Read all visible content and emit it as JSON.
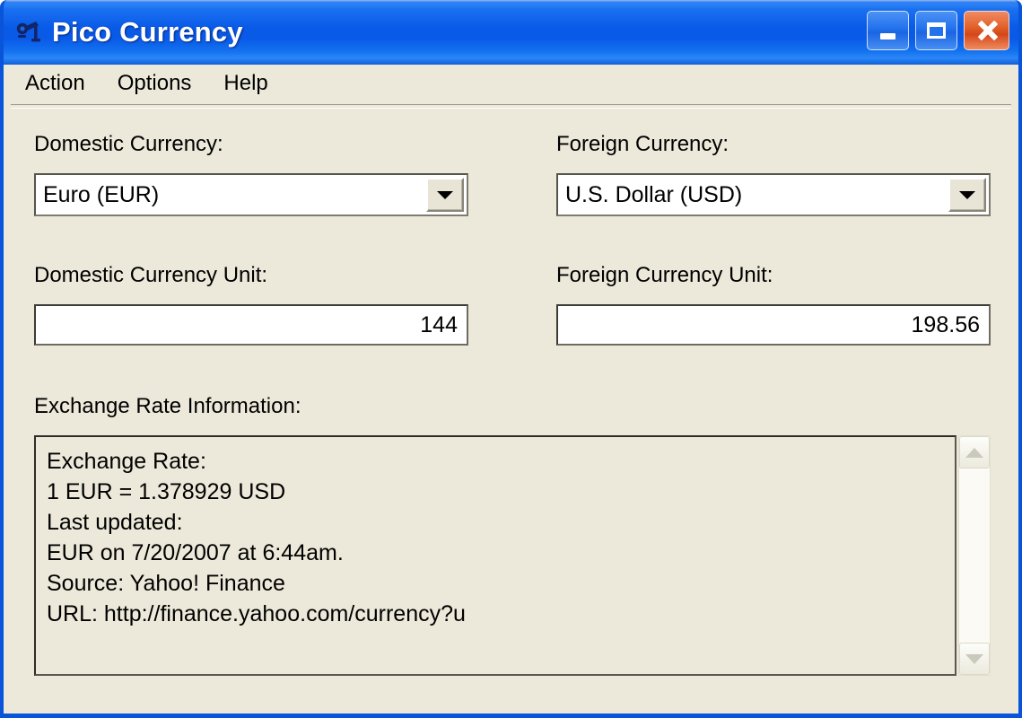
{
  "window": {
    "title": "Pico Currency",
    "icon": "app-icon",
    "controls": {
      "minimize": "minimize-button",
      "maximize": "maximize-button",
      "close": "close-button"
    },
    "colors": {
      "titlebar_blue": "#0a5ae8",
      "client_background": "#ece9da",
      "close_button": "#d4471a",
      "field_background": "#ffffff"
    }
  },
  "menubar": {
    "items": [
      {
        "label": "Action"
      },
      {
        "label": "Options"
      },
      {
        "label": "Help"
      }
    ]
  },
  "form": {
    "domestic_currency": {
      "label": "Domestic Currency:",
      "value": "Euro (EUR)"
    },
    "foreign_currency": {
      "label": "Foreign Currency:",
      "value": "U.S. Dollar (USD)"
    },
    "domestic_unit": {
      "label": "Domestic Currency Unit:",
      "value": "144"
    },
    "foreign_unit": {
      "label": "Foreign Currency Unit:",
      "value": "198.56"
    },
    "exchange_rate_info": {
      "label": "Exchange Rate Information:",
      "lines": [
        "Exchange Rate:",
        "1 EUR =  1.378929 USD",
        "Last updated:",
        "EUR on 7/20/2007 at 6:44am.",
        "Source: Yahoo! Finance",
        "URL: http://finance.yahoo.com/currency?u"
      ]
    }
  }
}
